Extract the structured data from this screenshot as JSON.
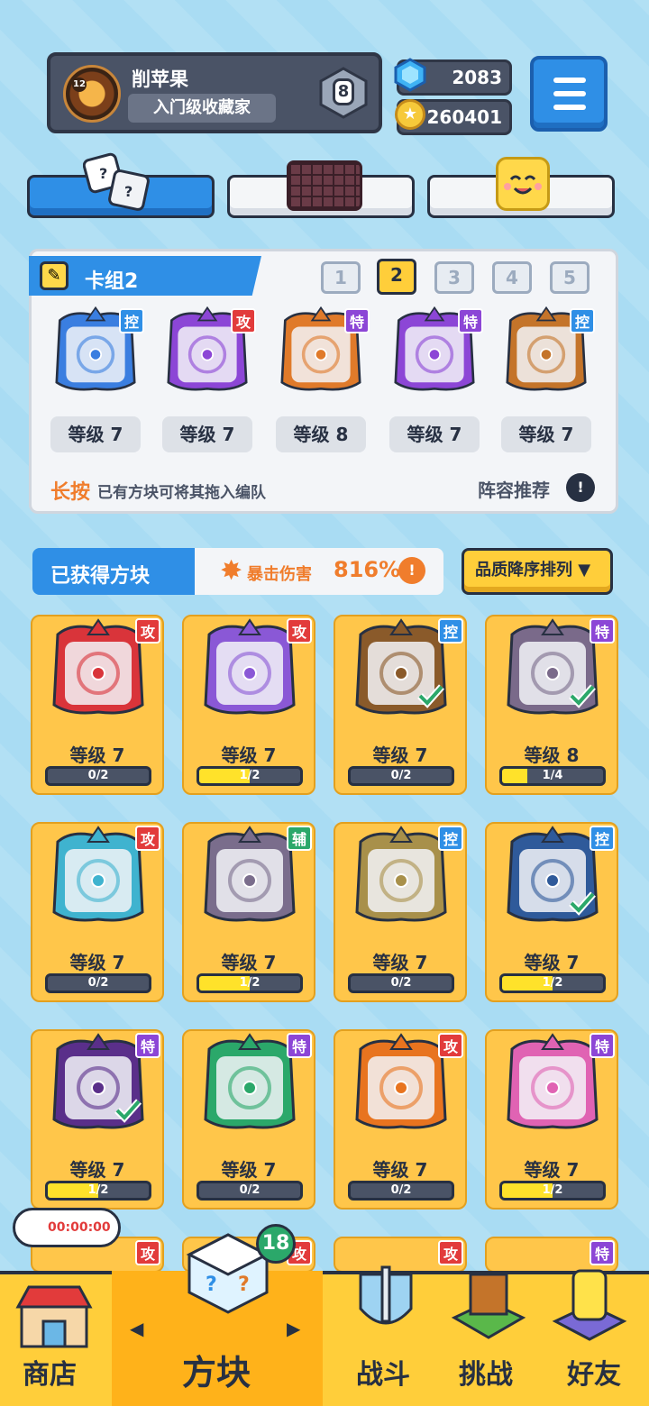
{
  "profile": {
    "name": "削苹果",
    "title": "入门级收藏家",
    "avatar_level": "12",
    "rank": "8"
  },
  "currency": {
    "gems": "2083",
    "coins": "260401"
  },
  "deck": {
    "title": "卡组2",
    "numbers": [
      "1",
      "2",
      "3",
      "4",
      "5"
    ],
    "active_number": "2",
    "cards": [
      {
        "badge": "控",
        "level": "等级 7",
        "color": "#3a7ee0"
      },
      {
        "badge": "攻",
        "level": "等级 7",
        "color": "#8c46d6"
      },
      {
        "badge": "特",
        "level": "等级 8",
        "color": "#e07a2a"
      },
      {
        "badge": "特",
        "level": "等级 7",
        "color": "#8c46d6"
      },
      {
        "badge": "控",
        "level": "等级 7",
        "color": "#c4742a"
      }
    ],
    "hint_highlight": "长按",
    "hint_rest": "已有方块可将其拖入编队",
    "lineup_label": "阵容推荐"
  },
  "owned": {
    "title": "已获得方块",
    "crit_label": "暴击伤害",
    "crit_value": "816%",
    "sort_label": "品质降序排列 ▼",
    "tiles": [
      {
        "badge": "攻",
        "level": "等级 7",
        "progress": "0/2",
        "fill": 0,
        "color": "#d9343a",
        "check": false
      },
      {
        "badge": "攻",
        "level": "等级 7",
        "progress": "1/2",
        "fill": 0.5,
        "color": "#8a58d6",
        "check": false
      },
      {
        "badge": "控",
        "level": "等级 7",
        "progress": "0/2",
        "fill": 0,
        "color": "#8a5a2a",
        "check": true
      },
      {
        "badge": "特",
        "level": "等级 8",
        "progress": "1/4",
        "fill": 0.25,
        "color": "#7a6a8a",
        "check": true
      },
      {
        "badge": "攻",
        "level": "等级 7",
        "progress": "0/2",
        "fill": 0,
        "color": "#3fb3cf",
        "check": false
      },
      {
        "badge": "辅",
        "level": "等级 7",
        "progress": "1/2",
        "fill": 0.5,
        "color": "#7a6d8c",
        "check": false
      },
      {
        "badge": "控",
        "level": "等级 7",
        "progress": "0/2",
        "fill": 0,
        "color": "#a8904a",
        "check": false
      },
      {
        "badge": "控",
        "level": "等级 7",
        "progress": "1/2",
        "fill": 0.5,
        "color": "#2f5a9a",
        "check": true
      },
      {
        "badge": "特",
        "level": "等级 7",
        "progress": "1/2",
        "fill": 0.5,
        "color": "#5a2f8a",
        "check": true
      },
      {
        "badge": "特",
        "level": "等级 7",
        "progress": "0/2",
        "fill": 0,
        "color": "#2ba86a",
        "check": false
      },
      {
        "badge": "攻",
        "level": "等级 7",
        "progress": "0/2",
        "fill": 0,
        "color": "#e8741f",
        "check": false
      },
      {
        "badge": "特",
        "level": "等级 7",
        "progress": "1/2",
        "fill": 0.5,
        "color": "#e063b3",
        "check": false
      }
    ],
    "partial_badges": [
      "攻",
      "攻",
      "攻",
      "特"
    ]
  },
  "nav": {
    "timer": "00:00:00",
    "count": "18",
    "items": [
      "商店",
      "方块",
      "战斗",
      "挑战",
      "好友"
    ]
  },
  "colors": {
    "background": "#a9dcf3",
    "accent_blue": "#2f8fe6",
    "accent_yellow": "#ffce3a",
    "attack": "#e23b3b",
    "control": "#2f8fe6",
    "special": "#8c46d6",
    "support": "#2ba86a"
  },
  "icons": [
    "gem-icon",
    "coin-icon",
    "menu-icon",
    "dice-icon",
    "grid-icon",
    "smile-icon",
    "pencil-icon",
    "info-icon",
    "crit-icon",
    "timer-icon",
    "shop-icon",
    "block-icon",
    "battle-icon",
    "challenge-icon",
    "friends-icon"
  ]
}
